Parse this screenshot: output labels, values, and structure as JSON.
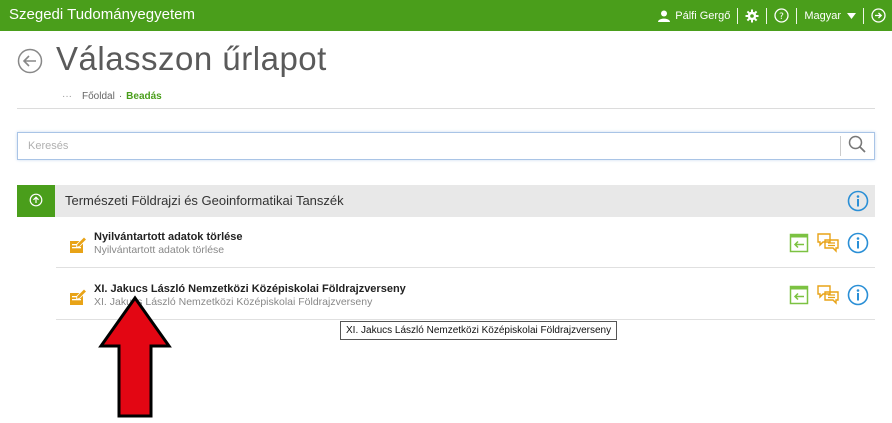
{
  "header": {
    "brand": "Szegedi Tudományegyetem",
    "user_name": "Pálfi Gergő",
    "language": "Magyar",
    "color": "#4a9e1b"
  },
  "page": {
    "title": "Válasszon űrlapot",
    "breadcrumb": {
      "ellipsis": "···",
      "home": "Főoldal",
      "separator": "·",
      "current": "Beadás"
    }
  },
  "search": {
    "placeholder": "Keresés",
    "value": ""
  },
  "category": {
    "label": "Természeti Földrajzi és Geoinformatikai Tanszék"
  },
  "forms": [
    {
      "title": "Nyilvántartott adatok törlése",
      "subtitle": "Nyilvántartott adatok törlése"
    },
    {
      "title": "XI. Jakucs László Nemzetközi Középiskolai Földrajzverseny",
      "subtitle": "XI. Jakucs László Nemzetközi Középiskolai Földrajzverseny"
    }
  ],
  "tooltip": {
    "text": "XI. Jakucs László Nemzetközi Középiskolai Földrajzverseny"
  },
  "icons": {
    "back": "back-arrow-icon",
    "user": "user-icon",
    "settings": "gear-icon",
    "help": "help-icon",
    "logout": "logout-icon",
    "search": "search-icon",
    "collapse": "collapse-icon",
    "info": "info-icon",
    "form": "form-edit-icon",
    "submit": "submit-icon",
    "comment": "comment-icon"
  },
  "colors": {
    "accent": "#4a9e1b",
    "icon_orange": "#e8a317",
    "icon_green": "#7cc242",
    "annotation_red": "#e30613"
  }
}
